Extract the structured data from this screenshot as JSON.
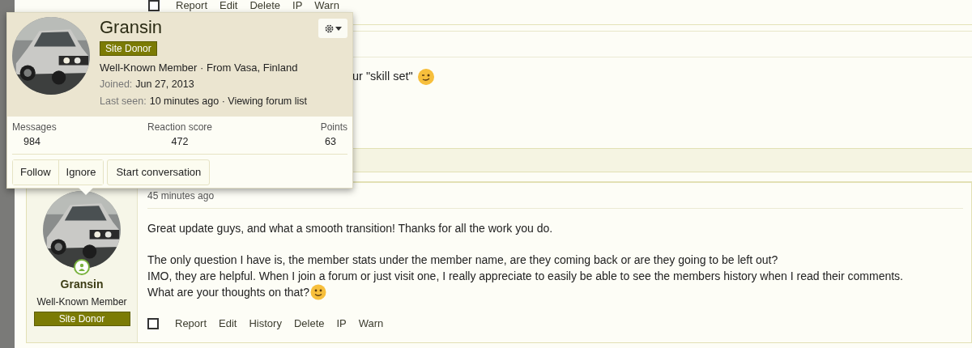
{
  "top_post": {
    "checkbox": {
      "checked": false
    },
    "actions": [
      "Report",
      "Edit",
      "Delete",
      "IP",
      "Warn"
    ],
    "message_fragment": "ur \"skill set\""
  },
  "member_card": {
    "name": "Gransin",
    "badge": "Site Donor",
    "title_line": "Well-Known Member · From Vasa, Finland",
    "joined_label": "Joined:",
    "joined": "Jun 27, 2013",
    "last_seen_label": "Last seen:",
    "last_seen": "10 minutes ago · Viewing forum list",
    "stats": [
      {
        "label": "Messages",
        "value": "984"
      },
      {
        "label": "Reaction score",
        "value": "472"
      },
      {
        "label": "Points",
        "value": "63"
      }
    ],
    "buttons": [
      "Follow",
      "Ignore",
      "Start conversation"
    ]
  },
  "post": {
    "author": "Gransin",
    "online": true,
    "user_title": "Well-Known Member",
    "badge": "Site Donor",
    "time": "45 minutes ago",
    "paragraphs": [
      [
        "Great update guys, and what a smooth transition! Thanks for all the work you do."
      ],
      [
        "The only question I have is, the member stats under the member name, are they coming back or are they going to be left out?",
        "IMO, they are helpful. When I join a forum or just visit one, I really appreciate to easily be able to see the members history when I read their comments.",
        "What are your thoughts on that?"
      ]
    ],
    "checkbox": {
      "checked": false
    },
    "actions": [
      "Report",
      "Edit",
      "History",
      "Delete",
      "IP",
      "Warn"
    ]
  }
}
